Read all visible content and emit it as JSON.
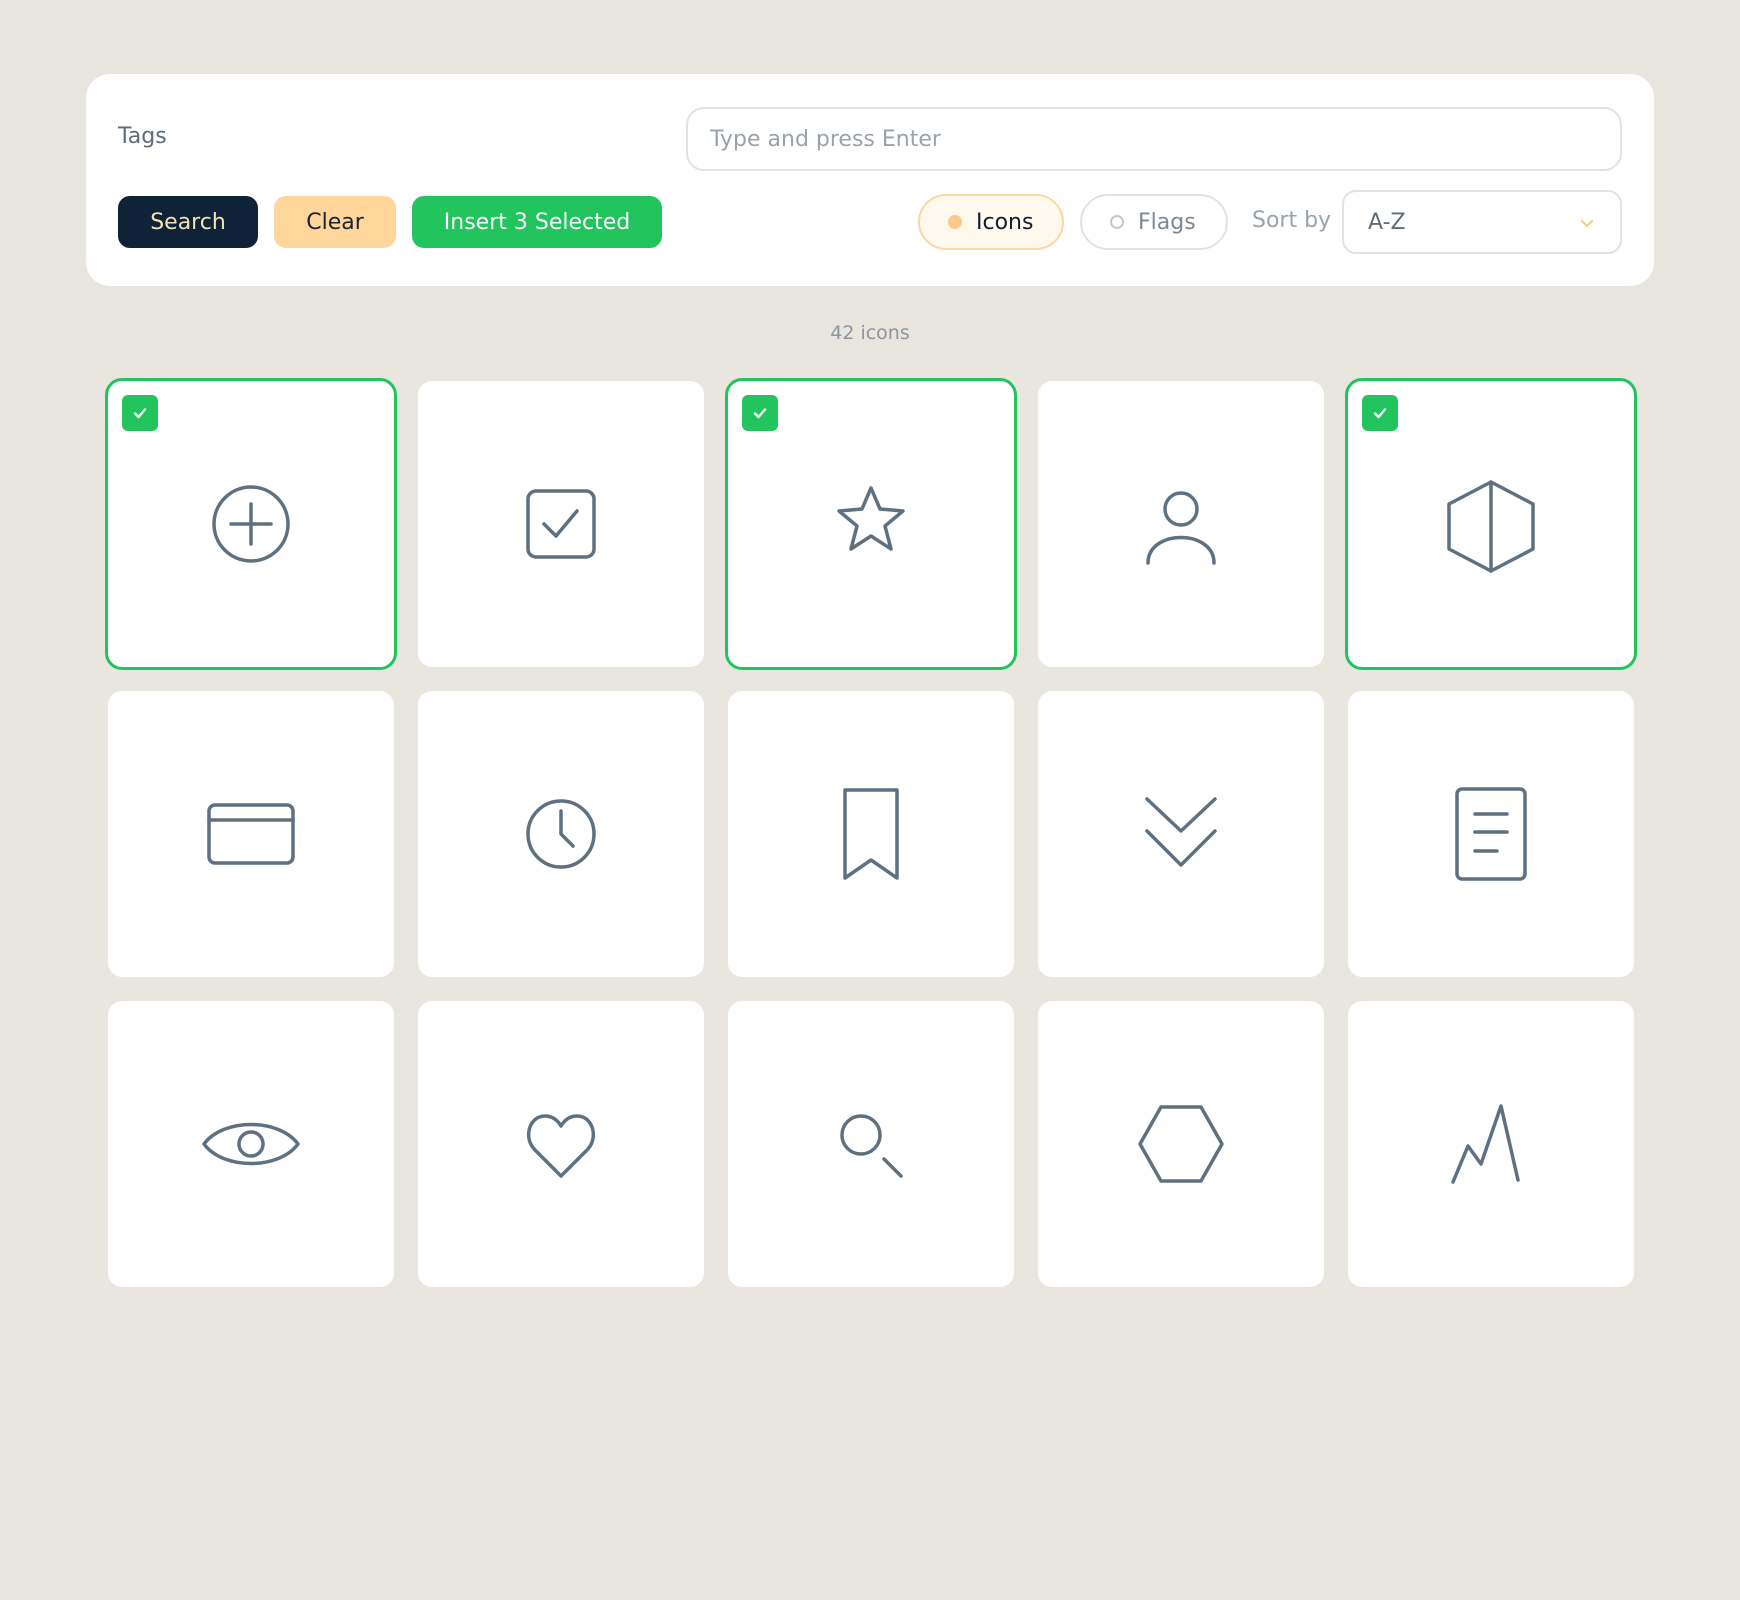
{
  "toolbar": {
    "tags_label": "Tags",
    "tag_input_placeholder": "Type and press Enter",
    "tag_input_value": "",
    "search_label": "Search",
    "clear_label": "Clear",
    "insert_label": "Insert 3 Selected",
    "filters": [
      {
        "label": "Icons",
        "active": true
      },
      {
        "label": "Flags",
        "active": false
      }
    ],
    "sort_label": "Sort by",
    "sort_value": "A-Z"
  },
  "count_text": "42 icons",
  "colors": {
    "accent": "#22c45e",
    "dark": "#0e2238",
    "peach": "#fed59a",
    "icon_stroke": "#5f7181",
    "background": "#e8e6df"
  },
  "icons": [
    {
      "name": "plus-circle-icon",
      "selected": true
    },
    {
      "name": "checkbox-icon",
      "selected": false
    },
    {
      "name": "star-icon",
      "selected": true
    },
    {
      "name": "user-icon",
      "selected": false
    },
    {
      "name": "box-icon",
      "selected": true
    },
    {
      "name": "credit-card-icon",
      "selected": false
    },
    {
      "name": "clock-icon",
      "selected": false
    },
    {
      "name": "bookmark-icon",
      "selected": false
    },
    {
      "name": "chevrons-down-icon",
      "selected": false
    },
    {
      "name": "document-icon",
      "selected": false
    },
    {
      "name": "eye-icon",
      "selected": false
    },
    {
      "name": "heart-icon",
      "selected": false
    },
    {
      "name": "search-icon",
      "selected": false
    },
    {
      "name": "hexagon-icon",
      "selected": false
    },
    {
      "name": "mountain-icon",
      "selected": false
    }
  ]
}
